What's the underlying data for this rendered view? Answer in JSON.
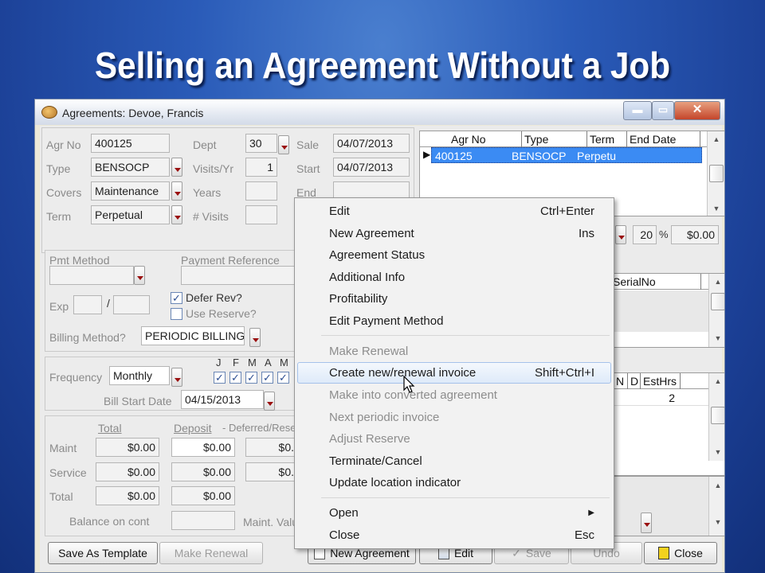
{
  "slide_title": "Selling an Agreement Without a Job",
  "window": {
    "title": "Agreements: Devoe, Francis",
    "min": "▬",
    "max": "▭",
    "close": "✕"
  },
  "fields": {
    "agr_no_label": "Agr No",
    "agr_no": "400125",
    "type_label": "Type",
    "type": "BENSOCP",
    "covers_label": "Covers",
    "covers": "Maintenance",
    "term_label": "Term",
    "term": "Perpetual",
    "dept_label": "Dept",
    "dept": "30",
    "visits_label": "Visits/Yr",
    "visits": "1",
    "years_label": "Years",
    "numvisits_label": "# Visits",
    "sale_label": "Sale",
    "sale": "04/07/2013",
    "start_label": "Start",
    "start": "04/07/2013",
    "end_label": "End"
  },
  "grid1": {
    "headers": [
      "Agr No",
      "Type",
      "Term",
      "End Date"
    ],
    "row": [
      "400125",
      "BENSOCP",
      "Perpetu",
      ""
    ],
    "pointer": "▶"
  },
  "mid_right": {
    "percent": "20",
    "percent_sym": "%",
    "amount": "$0.00"
  },
  "grid2": {
    "header": "SerialNo"
  },
  "grid3": {
    "headers": [
      "N",
      "D",
      "EstHrs"
    ],
    "row_val": "2"
  },
  "scroll": {
    "up": "▲",
    "down": "▼"
  },
  "payment": {
    "pmt_method_label": "Pmt Method",
    "pmt_ref_label": "Payment Reference",
    "defer_rev_label": "Defer Rev?",
    "defer_rev_mark": "✓",
    "use_reserve_label": "Use Reserve?",
    "exp_label": "Exp",
    "exp_sep": "/",
    "billing_method_label": "Billing Method?",
    "billing_method": "PERIODIC BILLING"
  },
  "frequency": {
    "label": "Frequency",
    "value": "Monthly",
    "months": [
      "J",
      "F",
      "M",
      "A",
      "M"
    ],
    "check_mark": "✓",
    "bill_start_label": "Bill Start Date",
    "bill_start": "04/15/2013"
  },
  "totals": {
    "total_h": "Total",
    "deposit_h": "Deposit",
    "deferred_h": "- Deferred/Rese",
    "rows": [
      {
        "label": "Maint",
        "total": "$0.00",
        "deposit": "$0.00",
        "deferred": "$0."
      },
      {
        "label": "Service",
        "total": "$0.00",
        "deposit": "$0.00",
        "deferred": "$0."
      },
      {
        "label": "Total",
        "total": "$0.00",
        "deposit": "$0.00"
      }
    ],
    "balance_label": "Balance on cont",
    "maint_value_label": "Maint. Valu"
  },
  "buttons": {
    "save_template": "Save As Template",
    "make_renewal": "Make Renewal",
    "new_agreement": "New Agreement",
    "edit": "Edit",
    "save": "Save",
    "undo": "Undo",
    "close": "Close"
  },
  "menu": {
    "group1": [
      {
        "label": "Edit",
        "shortcut": "Ctrl+Enter"
      },
      {
        "label": "New Agreement",
        "shortcut": "Ins"
      },
      {
        "label": "Agreement Status",
        "shortcut": ""
      },
      {
        "label": "Additional Info",
        "shortcut": ""
      },
      {
        "label": "Profitability",
        "shortcut": ""
      },
      {
        "label": "Edit Payment Method",
        "shortcut": ""
      }
    ],
    "group2": [
      {
        "label": "Make Renewal",
        "shortcut": ""
      },
      {
        "label": "Create new/renewal invoice",
        "shortcut": "Shift+Ctrl+I"
      },
      {
        "label": "Make into converted agreement",
        "shortcut": ""
      },
      {
        "label": "Next periodic invoice",
        "shortcut": ""
      },
      {
        "label": "Adjust Reserve",
        "shortcut": ""
      },
      {
        "label": "Terminate/Cancel",
        "shortcut": ""
      },
      {
        "label": "Update location indicator",
        "shortcut": ""
      }
    ],
    "group3": [
      {
        "label": "Open",
        "shortcut": "▶"
      },
      {
        "label": "Close",
        "shortcut": "Esc"
      }
    ]
  }
}
